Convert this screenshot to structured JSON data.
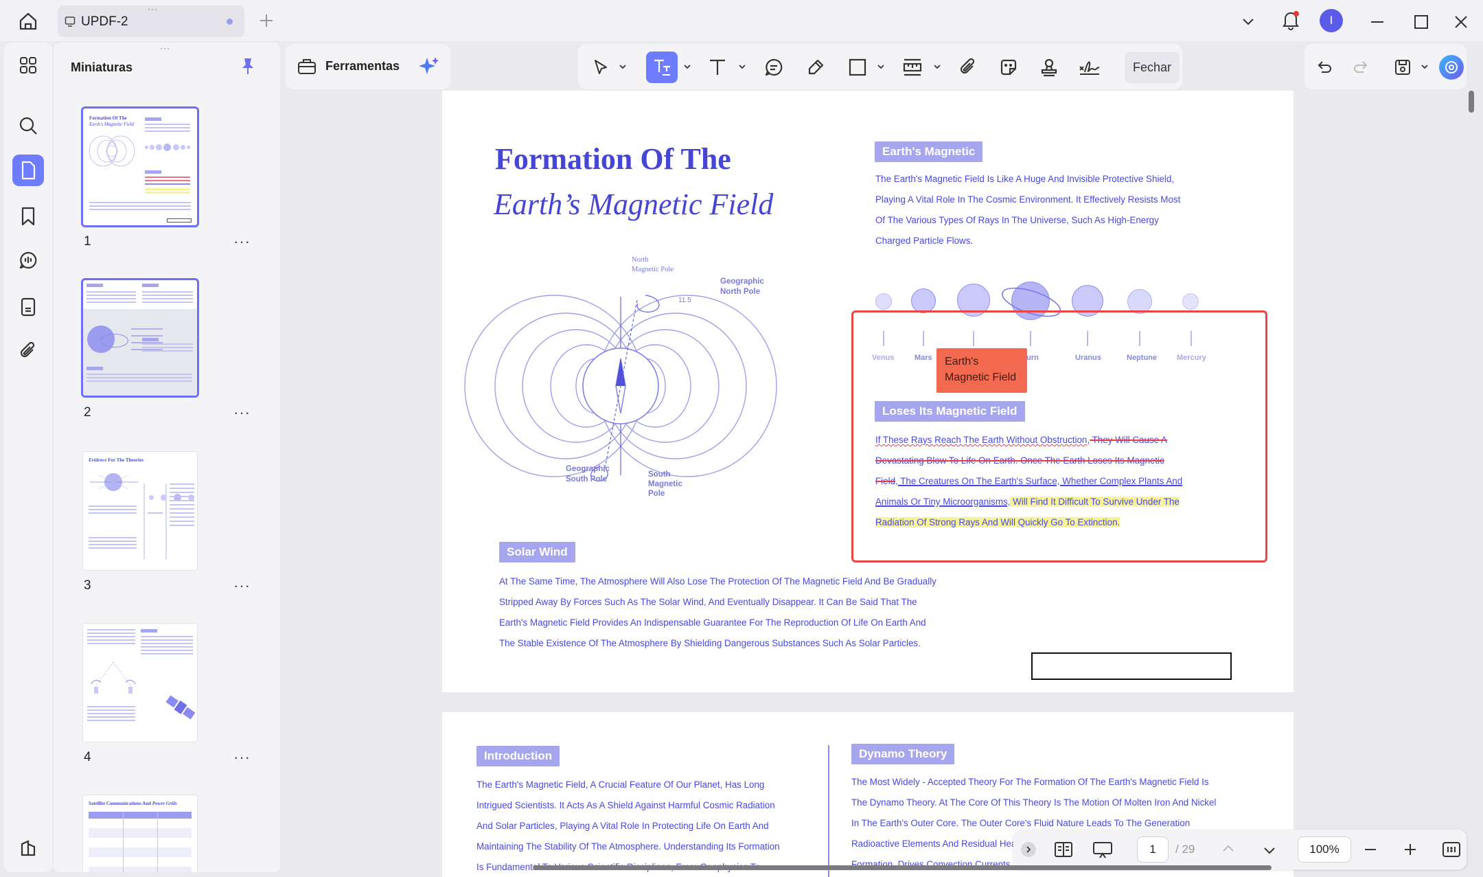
{
  "window": {
    "tab_title": "UPDF-2"
  },
  "thumbnails": {
    "title": "Miniaturas",
    "pages": [
      "1",
      "2",
      "3",
      "4"
    ],
    "more": "···"
  },
  "toolbar": {
    "tools_label": "Ferramentas",
    "close_label": "Fechar"
  },
  "page1": {
    "title_line1": "Formation Of The",
    "title_line2": "Earth’s Magnetic Field",
    "diagram": {
      "north_magnetic": [
        "North",
        "Magnetic Pole"
      ],
      "geo_north": [
        "Geographic",
        "North Pole"
      ],
      "geo_south": [
        "Geographic",
        "South Pole"
      ],
      "south_magnetic": [
        "South",
        "Magnetic",
        "Pole"
      ],
      "angle": "11.5"
    },
    "earths_magnetic_label": "Earth's Magnetic",
    "earths_magnetic_text": [
      "The Earth's Magnetic Field Is Like A Huge And Invisible Protective Shield,",
      "Playing A Vital Role In The Cosmic Environment. It Effectively Resists Most",
      "Of The Various Types Of Rays In The Universe, Such As High-Energy",
      "Charged Particle Flows."
    ],
    "planets": [
      "Venus",
      "Mars",
      "Saturn",
      "Uranus",
      "Neptune",
      "Mercury"
    ],
    "callout_text": "Earth's Magnetic Field",
    "loses_label": "Loses Its Magnetic Field",
    "loses_text": {
      "l1a": "If These Rays Reach The Earth Without Obstruction,",
      "l1b": " They Will Cause A",
      "l2": "Devastating Blow To Life On Earth. Once The Earth Loses Its Magnetic",
      "l3a": "Field",
      "l3b": ", The Creatures On The Earth's Surface, Whether Complex Plants And",
      "l4a": "Animals Or Tiny Microorganisms,",
      "l4b": " Will Find It Difficult To Survive Under The",
      "l5": "Radiation Of Strong Rays And Will Quickly Go To Extinction."
    },
    "solar_wind_label": "Solar Wind",
    "solar_wind_text": [
      "At The Same Time, The Atmosphere Will Also Lose The Protection Of The Magnetic Field And Be Gradually",
      "Stripped Away By Forces Such As The Solar Wind, And Eventually Disappear. It Can Be Said That The",
      "Earth's Magnetic Field Provides An Indispensable Guarantee For The Reproduction Of Life On Earth And",
      "The Stable Existence Of The Atmosphere By Shielding Dangerous Substances Such As Solar Particles."
    ]
  },
  "page2": {
    "intro_label": "Introduction",
    "intro_text": [
      "The Earth's Magnetic Field, A Crucial Feature Of Our Planet, Has Long",
      "Intrigued Scientists. It Acts As A Shield Against Harmful Cosmic Radiation",
      "And Solar Particles, Playing A Vital Role In Protecting Life On Earth And",
      "Maintaining The Stability Of The Atmosphere. Understanding Its Formation",
      "Is Fundamental To Various Scientific Disciplines, From Geophysics To"
    ],
    "dynamo_label": "Dynamo Theory",
    "dynamo_text": [
      "The Most Widely - Accepted Theory For The Formation Of The Earth's Magnetic Field Is",
      "The Dynamo Theory. At The Core Of This Theory Is The Motion Of Molten Iron And Nickel",
      "In The Earth's Outer Core. The Outer Core's Fluid Nature Leads To The Generation",
      "Radioactive Elements And Residual Heat From The Earth's",
      "Formation, Drives Convection Currents"
    ]
  },
  "thumb_text": {
    "t1_title_a": "Formation Of The",
    "t1_title_b": "Earth's Magnetic Field",
    "t3_title_a": "Evidence",
    "t3_title_b": " For The Theories",
    "t5_title_a": "Satellite Communications And ",
    "t5_title_b": "Power Grids"
  },
  "navigation": {
    "current_page": "1",
    "total_pages": "/ 29",
    "zoom": "100%"
  },
  "colors": {
    "accent": "#6e7cff",
    "text_blue": "#4848e0",
    "annotation_red": "#e64646",
    "callout": "#f46a50",
    "highlight": "#f6f39a"
  }
}
